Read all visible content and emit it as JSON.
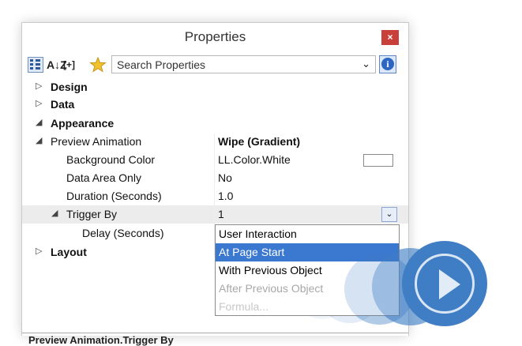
{
  "window": {
    "title": "Properties",
    "close_glyph": "×"
  },
  "toolbar": {
    "categorized_icon": "categorized-grid-icon",
    "sort_label": "A↓Z",
    "plus_label": "[+]",
    "search_placeholder": "Search Properties",
    "chevron": "⌄",
    "info_glyph": "i"
  },
  "grid": {
    "design": {
      "expander": "▷",
      "label": "Design"
    },
    "data": {
      "expander": "▷",
      "label": "Data"
    },
    "appearance": {
      "expander": "◢",
      "label": "Appearance"
    },
    "preview_animation": {
      "expander": "◢",
      "label": "Preview Animation",
      "value": "Wipe (Gradient)"
    },
    "background_color": {
      "label": "Background Color",
      "value": "LL.Color.White"
    },
    "data_area_only": {
      "label": "Data Area Only",
      "value": "No"
    },
    "duration": {
      "label": "Duration (Seconds)",
      "value": "1.0"
    },
    "trigger_by": {
      "expander": "◢",
      "label": "Trigger By",
      "value": "1",
      "dd_glyph": "⌄"
    },
    "delay": {
      "label": "Delay (Seconds)"
    },
    "layout": {
      "expander": "▷",
      "label": "Layout"
    }
  },
  "dropdown": {
    "options": [
      "User Interaction",
      "At Page Start",
      "With Previous Object",
      "After Previous Object",
      "Formula..."
    ],
    "selected_index": 1
  },
  "footer": {
    "text": "Preview Animation.Trigger By"
  },
  "colors": {
    "accent": "#3b78cf",
    "close": "#c9403a",
    "play": "#3f7ec4"
  }
}
